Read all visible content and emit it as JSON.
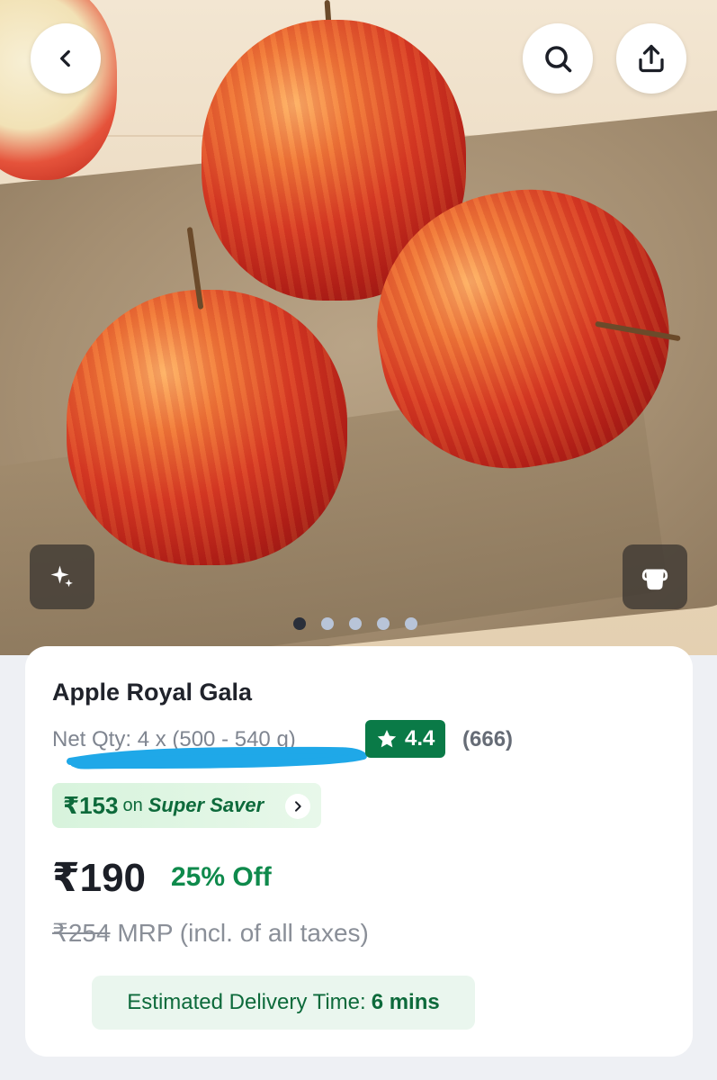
{
  "header": {
    "back_icon": "chevron-left-icon",
    "search_icon": "search-icon",
    "share_icon": "share-icon"
  },
  "gallery": {
    "image_count": 5,
    "active_index": 0,
    "ai_button_icon": "sparkle-icon",
    "second_button_icon": "cup-icon"
  },
  "product": {
    "title": "Apple Royal Gala",
    "net_qty": "Net Qty: 4 x (500 - 540 g)",
    "rating": "4.4",
    "rating_count": "(666)",
    "super_saver": {
      "amount": "₹153",
      "on": "on",
      "label": "Super Saver"
    },
    "price": "₹190",
    "discount": "25% Off",
    "mrp_value": "₹254",
    "mrp_text": "MRP (incl. of all taxes)",
    "eta_label": "Estimated Delivery Time:",
    "eta_value": "6 mins"
  },
  "colors": {
    "accent_green": "#0a7a47",
    "discount_green": "#0f8a4c",
    "scribble_blue": "#1fa8e8"
  }
}
